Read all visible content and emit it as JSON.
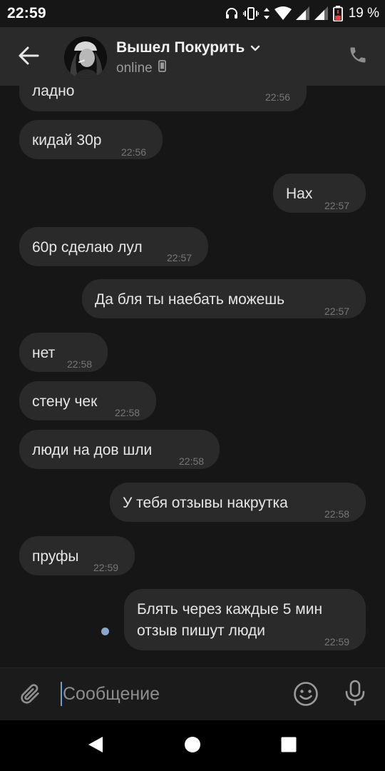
{
  "status_bar": {
    "time": "22:59",
    "battery_percent": "19 %",
    "icons": [
      "headset-icon",
      "vibrate-icon",
      "data-arrows-icon",
      "wifi-icon",
      "signal-icon",
      "signal-icon",
      "battery-icon"
    ]
  },
  "header": {
    "back_icon": "arrow-left-icon",
    "title": "Вышел Покурить",
    "title_icon": "chevron-down-icon",
    "status": "online",
    "status_icon": "phone-device-icon",
    "call_icon": "phone-icon"
  },
  "messages": [
    {
      "direction": "in",
      "text": "ладно",
      "time": "22:56"
    },
    {
      "direction": "in",
      "text": "кидай 30р",
      "time": "22:56"
    },
    {
      "direction": "out",
      "text": "Нах",
      "time": "22:57"
    },
    {
      "direction": "in",
      "text": "60р сделаю лул",
      "time": "22:57"
    },
    {
      "direction": "out",
      "text": "Да бля ты наебать можешь",
      "time": "22:57"
    },
    {
      "direction": "in",
      "text": "нет",
      "time": "22:58"
    },
    {
      "direction": "in",
      "text": "стену чек",
      "time": "22:58"
    },
    {
      "direction": "in",
      "text": "люди на дов шли",
      "time": "22:58"
    },
    {
      "direction": "out",
      "text": "У тебя отзывы накрутка",
      "time": "22:58"
    },
    {
      "direction": "in",
      "text": "пруфы",
      "time": "22:59"
    },
    {
      "direction": "out",
      "text_lines": [
        "Блять через каждые 5 мин",
        "отзыв пишут люди"
      ],
      "time": "22:59",
      "unread": true
    }
  ],
  "composer": {
    "placeholder": "Сообщение",
    "attach_icon": "paperclip-icon",
    "emoji_icon": "smiley-icon",
    "mic_icon": "microphone-icon"
  },
  "nav_bar": {
    "icons": [
      "triangle-back-icon",
      "circle-home-icon",
      "square-recents-icon"
    ]
  },
  "colors": {
    "background": "#161616",
    "header": "#2a2a2a",
    "bubble": "#2a2a2b",
    "accent": "#8aa6c8",
    "cursor": "#6f9fd6"
  }
}
